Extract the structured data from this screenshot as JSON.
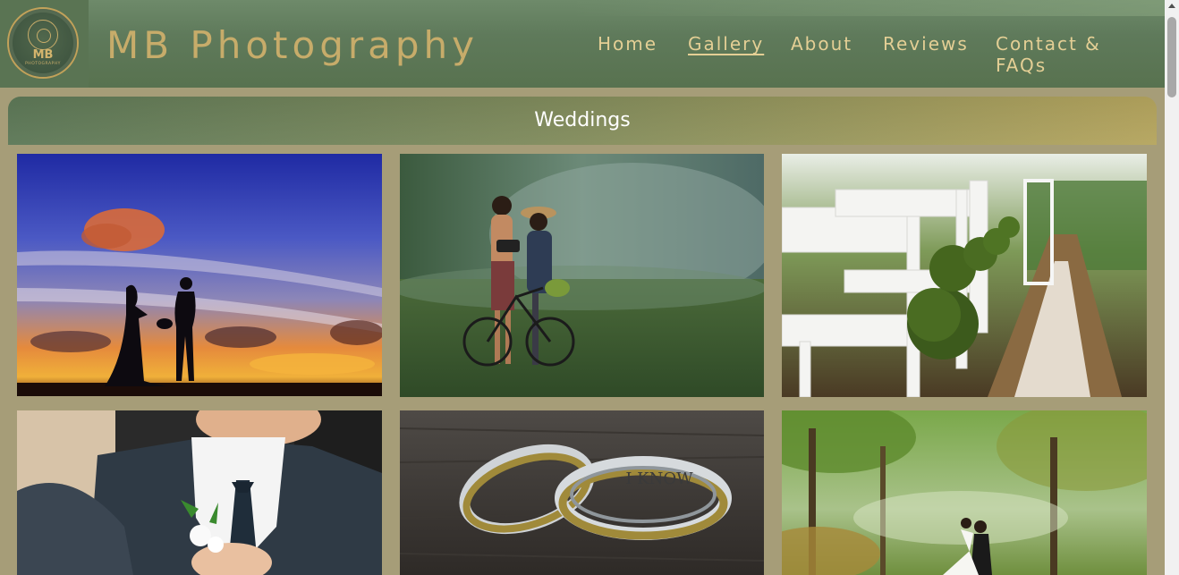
{
  "header": {
    "logo_text": "MB",
    "logo_subtext": "PHOTOGRAPHY",
    "site_title": "MB Photography"
  },
  "nav": {
    "items": [
      {
        "label": "Home"
      },
      {
        "label": "Gallery",
        "active": true
      },
      {
        "label": "About"
      },
      {
        "label": "Reviews"
      },
      {
        "label": "Contact &"
      },
      {
        "label": "FAQs"
      }
    ]
  },
  "section": {
    "title": "Weddings"
  },
  "gallery": {
    "photos": [
      {
        "name": "silhouette-couple-sunset-photo"
      },
      {
        "name": "couple-with-bicycle-photo"
      },
      {
        "name": "aisle-chairs-moss-balls-photo"
      },
      {
        "name": "groom-boutonniere-photo"
      },
      {
        "name": "wedding-rings-photo",
        "engraving": "I KNOW"
      },
      {
        "name": "couple-in-forest-photo"
      }
    ]
  },
  "colors": {
    "page_background": "#a69d78",
    "header_green": "#5f7a5b",
    "gold_accent": "#c7ac6a",
    "nav_text": "#e4cf95"
  }
}
